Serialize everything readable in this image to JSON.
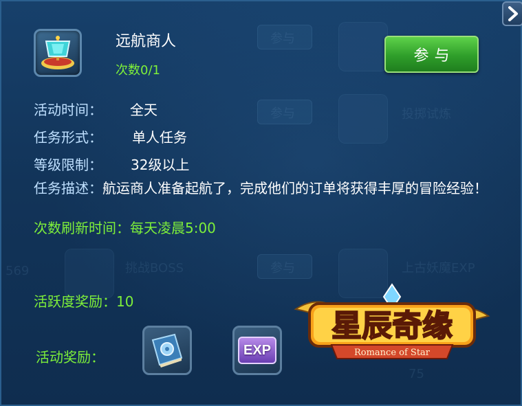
{
  "activity": {
    "title": "远航商人",
    "count_label": "次数0/1",
    "join_label": "参与"
  },
  "details": {
    "time_label": "活动时间：",
    "time_value": "全天",
    "form_label": "任务形式：",
    "form_value": "单人任务",
    "level_label": "等级限制：",
    "level_value": "32级以上",
    "desc_label": "任务描述：",
    "desc_text": "航运商人准备起航了，完成他们的订单将获得丰厚的冒险经验！",
    "refresh_text": "次数刷新时间：每天凌晨5:00",
    "activity_reward_label": "活跃度奖励：",
    "activity_reward_value": "10",
    "reward_label": "活动奖励："
  },
  "rewards": [
    {
      "icon": "spellbook-icon"
    },
    {
      "icon": "exp-icon",
      "text": "EXP"
    }
  ],
  "logo": {
    "name": "星辰奇缘",
    "subtitle": "Romance of Star"
  },
  "background_faint": {
    "items": [
      "挑战BOSS",
      "上古妖魔EXP",
      "投掷试炼"
    ],
    "buttons": [
      "参与",
      "参与",
      "参与"
    ],
    "numbers": [
      "569",
      "75"
    ]
  }
}
